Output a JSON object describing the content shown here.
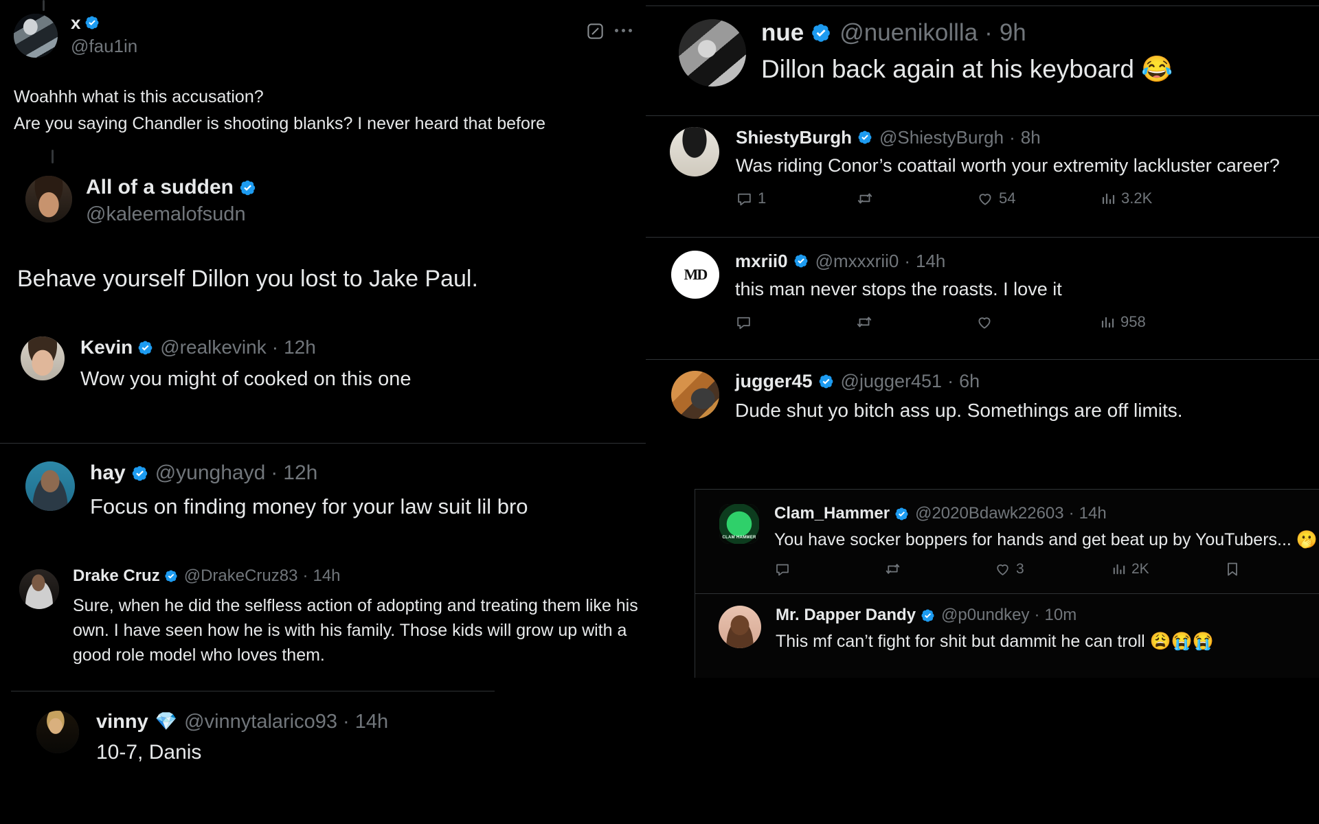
{
  "meta": {
    "app": "X (Twitter)",
    "theme": "dark",
    "background": "#000000",
    "accent_verified": "#1d9bf0",
    "muted_text": "#71767b",
    "primary_text": "#e7e9ea",
    "divider": "#2f3336"
  },
  "icons": {
    "note": "note-edit-icon",
    "more": "more-options-icon",
    "reply": "reply-icon",
    "retweet": "retweet-icon",
    "like": "like-heart-icon",
    "views": "views-bars-icon",
    "bookmark": "bookmark-icon",
    "verified": "verified-badge-icon",
    "gem": "gem-badge-icon"
  },
  "left_panel": {
    "tweets": [
      {
        "display_name": "x",
        "verified": true,
        "handle": "@fau1in",
        "timestamp": "",
        "avatar": "ph-fau",
        "text_lines": [
          "Woahhh what is this accusation?",
          "Are you saying Chandler is shooting blanks? I never heard that before"
        ]
      },
      {
        "display_name": "All of a sudden",
        "verified": true,
        "handle": "@kaleemalofsudn",
        "timestamp": "",
        "avatar": "ph-kaleem",
        "text_lines": [
          "Behave yourself Dillon you lost to Jake Paul."
        ]
      },
      {
        "display_name": "Kevin",
        "verified": true,
        "handle": "@realkevink",
        "timestamp": "12h",
        "avatar": "ph-kevin",
        "text_lines": [
          "Wow you might of cooked on this one"
        ]
      },
      {
        "display_name": "hay",
        "verified": true,
        "handle": "@yunghayd",
        "timestamp": "12h",
        "avatar": "ph-hay",
        "text_lines": [
          "Focus on finding money for your law suit lil bro"
        ]
      },
      {
        "display_name": "Drake Cruz",
        "verified": true,
        "handle": "@DrakeCruz83",
        "timestamp": "14h",
        "avatar": "ph-drake",
        "text_lines": [
          "Sure, when he did the selfless action of adopting and treating them like his",
          "own. I have seen how he is with his family. Those kids will grow up with a",
          "good role model who loves them."
        ]
      },
      {
        "display_name": "vinny",
        "verified": false,
        "gem": true,
        "handle": "@vinnytalarico93",
        "timestamp": "14h",
        "avatar": "ph-vinny",
        "text_lines": [
          "10-7, Danis"
        ]
      }
    ]
  },
  "right_panel": {
    "tweets": [
      {
        "display_name": "nue",
        "verified": true,
        "handle": "@nuenikollla",
        "timestamp": "9h",
        "avatar": "ph-nue",
        "text_lines": [
          "Dillon back again at his keyboard 😂"
        ],
        "actions": null
      },
      {
        "display_name": "ShiestyBurgh",
        "verified": true,
        "handle": "@ShiestyBurgh",
        "timestamp": "8h",
        "avatar": "ph-shiesty",
        "text_lines": [
          "Was riding Conor’s coattail worth your extremity lackluster career?"
        ],
        "actions": {
          "reply": "1",
          "retweet": "",
          "like": "54",
          "views": "3.2K"
        }
      },
      {
        "display_name": "mxrii0",
        "verified": true,
        "handle": "@mxxxrii0",
        "timestamp": "14h",
        "avatar": "ph-mxrii",
        "text_lines": [
          "this man never stops the roasts. I love it"
        ],
        "actions": {
          "reply": "",
          "retweet": "",
          "like": "",
          "views": "958"
        }
      },
      {
        "display_name": "jugger45",
        "verified": true,
        "handle": "@jugger451",
        "timestamp": "6h",
        "avatar": "ph-jugger",
        "text_lines": [
          "Dude shut yo bitch ass up. Somethings are off limits."
        ],
        "actions": null
      }
    ]
  },
  "overlay_panel": {
    "tweets": [
      {
        "display_name": "Clam_Hammer",
        "verified": true,
        "handle": "@2020Bdawk22603",
        "timestamp": "14h",
        "avatar": "ph-clam",
        "text_lines": [
          "You have socker boppers for hands and get beat up by YouTubers... 🫢"
        ],
        "actions": {
          "reply": "",
          "retweet": "",
          "like": "3",
          "views": "2K",
          "bookmark": true
        }
      },
      {
        "display_name": "Mr. Dapper Dandy",
        "verified": true,
        "handle": "@p0undkey",
        "timestamp": "10m",
        "avatar": "ph-dandy",
        "text_lines": [
          "This mf can’t fight for shit but dammit he can troll 😩😭😭"
        ],
        "actions": null
      }
    ]
  }
}
